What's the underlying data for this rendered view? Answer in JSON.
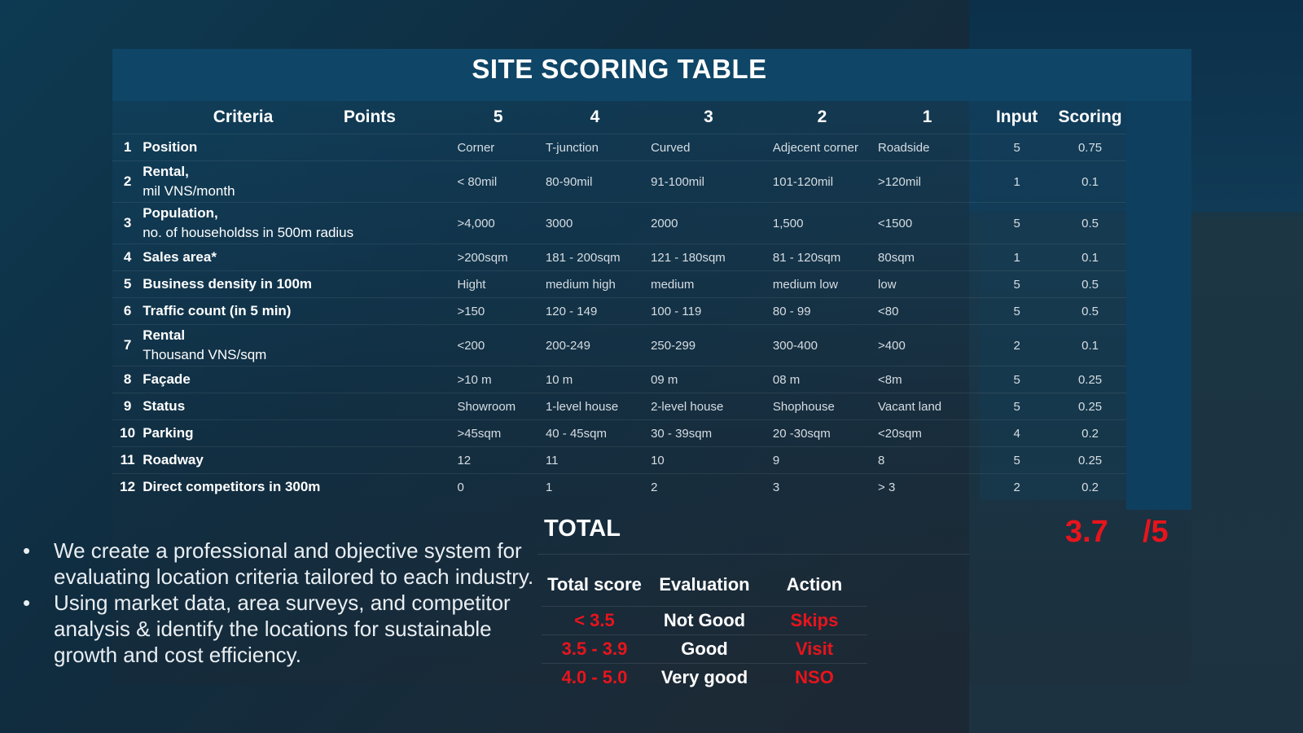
{
  "title": "SITE SCORING TABLE",
  "headers": {
    "criteria": "Criteria",
    "points": "Points",
    "p5": "5",
    "p4": "4",
    "p3": "3",
    "p2": "2",
    "p1": "1",
    "input": "Input",
    "scoring": "Scoring"
  },
  "rows": [
    {
      "no": "1",
      "name": "Position",
      "sub": "",
      "c5": "Corner",
      "c4": "T-junction",
      "c3": "Curved",
      "c2": "Adjecent corner",
      "c1": "Roadside",
      "input": "5",
      "score": "0.75"
    },
    {
      "no": "2",
      "name": "Rental,",
      "sub": "mil VNS/month",
      "c5": "< 80mil",
      "c4": "80-90mil",
      "c3": "91-100mil",
      "c2": "101-120mil",
      "c1": ">120mil",
      "input": "1",
      "score": "0.1"
    },
    {
      "no": "3",
      "name": "Population,",
      "sub": "no. of householdss in 500m radius",
      "c5": ">4,000",
      "c4": "3000",
      "c3": "2000",
      "c2": "1,500",
      "c1": "<1500",
      "input": "5",
      "score": "0.5"
    },
    {
      "no": "4",
      "name": "Sales area*",
      "sub": "",
      "c5": ">200sqm",
      "c4": "181 - 200sqm",
      "c3": "121 - 180sqm",
      "c2": "81 - 120sqm",
      "c1": "80sqm",
      "input": "1",
      "score": "0.1"
    },
    {
      "no": "5",
      "name": "Business density in 100m",
      "sub": "",
      "c5": "Hight",
      "c4": "medium high",
      "c3": "medium",
      "c2": "medium low",
      "c1": "low",
      "input": "5",
      "score": "0.5"
    },
    {
      "no": "6",
      "name": "Traffic count (in 5 min)",
      "sub": "",
      "c5": ">150",
      "c4": "120 - 149",
      "c3": "100 - 119",
      "c2": "80 - 99",
      "c1": "<80",
      "input": "5",
      "score": "0.5"
    },
    {
      "no": "7",
      "name": "Rental",
      "sub": "Thousand VNS/sqm",
      "c5": "<200",
      "c4": "200-249",
      "c3": "250-299",
      "c2": "300-400",
      "c1": ">400",
      "input": "2",
      "score": "0.1"
    },
    {
      "no": "8",
      "name": "Façade",
      "sub": "",
      "c5": ">10 m",
      "c4": "10 m",
      "c3": "09 m",
      "c2": "08 m",
      "c1": "<8m",
      "input": "5",
      "score": "0.25"
    },
    {
      "no": "9",
      "name": "Status",
      "sub": "",
      "c5": "Showroom",
      "c4": "1-level house",
      "c3": "2-level house",
      "c2": "Shophouse",
      "c1": "Vacant land",
      "input": "5",
      "score": "0.25"
    },
    {
      "no": "10",
      "name": "Parking",
      "sub": "",
      "c5": ">45sqm",
      "c4": "40 - 45sqm",
      "c3": "30 - 39sqm",
      "c2": "20 -30sqm",
      "c1": "<20sqm",
      "input": "4",
      "score": "0.2"
    },
    {
      "no": "11",
      "name": "Roadway",
      "sub": "",
      "c5": "12",
      "c4": "11",
      "c3": "10",
      "c2": "9",
      "c1": "8",
      "input": "5",
      "score": "0.25"
    },
    {
      "no": "12",
      "name": "Direct competitors in 300m",
      "sub": "",
      "c5": "0",
      "c4": "1",
      "c3": "2",
      "c2": "3",
      "c1": "> 3",
      "input": "2",
      "score": "0.2"
    }
  ],
  "total": {
    "label": "TOTAL",
    "value": "3.7",
    "max": "/5"
  },
  "legend": {
    "headers": [
      "Total score",
      "Evaluation",
      "Action"
    ],
    "rows": [
      {
        "range": "< 3.5",
        "evaluation": "Not Good",
        "action": "Skips"
      },
      {
        "range": "3.5 - 3.9",
        "evaluation": "Good",
        "action": "Visit"
      },
      {
        "range": "4.0 - 5.0",
        "evaluation": "Very good",
        "action": "NSO"
      }
    ]
  },
  "bullets": [
    "We create a professional and objective system for evaluating location criteria tailored to each industry.",
    "Using market data, area surveys, and competitor analysis & identify the locations for sustainable growth and cost efficiency."
  ],
  "bullet_glyph": "•",
  "colors": {
    "accent_red": "#e8141c",
    "title_bar": "#0f4566",
    "background": "#102c3f"
  }
}
